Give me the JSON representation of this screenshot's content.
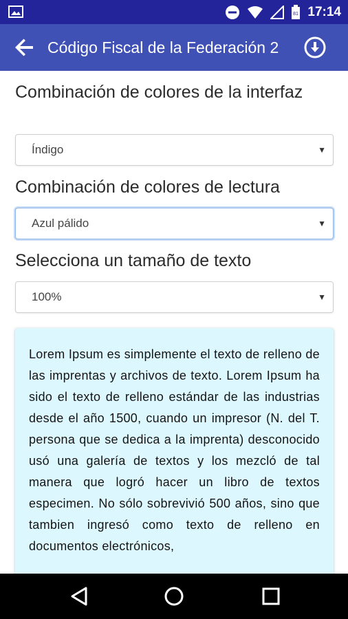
{
  "status_bar": {
    "time": "17:14",
    "icons": [
      "image-icon",
      "do-not-disturb-icon",
      "wifi-icon",
      "signal-icon",
      "battery-icon"
    ]
  },
  "app_bar": {
    "title": "Código Fiscal de la Federación 2",
    "back_icon": "arrow-back-icon",
    "download_icon": "download-icon",
    "color": "#3f51b5"
  },
  "settings": {
    "interface_label": "Combinación de colores de la interfaz",
    "interface_value": "Índigo",
    "reading_label": "Combinación de colores de lectura",
    "reading_value": "Azul pálido",
    "size_label": "Selecciona un tamaño de texto",
    "size_value": "100%",
    "dropdown_arrow": "▼"
  },
  "preview": {
    "text": "Lorem Ipsum es simplemente el texto de relleno de las imprentas y archivos de texto. Lorem Ipsum ha sido el texto de relleno estándar de las industrias desde el año 1500, cuando un impresor (N. del T. persona que se dedica a la imprenta) desconocido usó una galería de textos y los mezcló de tal manera que logró hacer un libro de textos especimen. No sólo sobrevivió 500 años, sino que tambien ingresó como texto de relleno en documentos electrónicos,",
    "background": "#dcf7fd"
  },
  "nav_bar": {
    "icons": [
      "back-triangle-icon",
      "home-circle-icon",
      "recents-square-icon"
    ]
  }
}
